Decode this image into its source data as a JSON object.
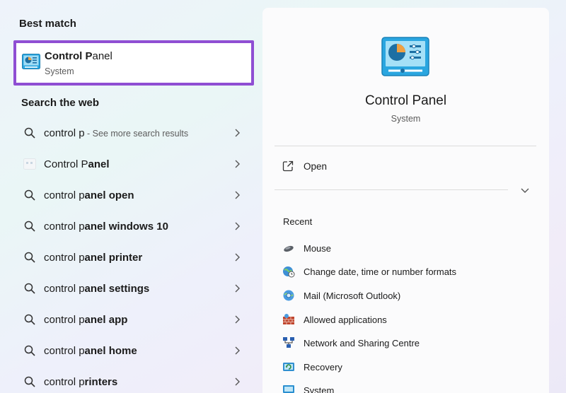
{
  "left": {
    "best_match_title": "Best match",
    "best_match": {
      "title_bold": "Control P",
      "title_rest": "anel",
      "subtitle": "System",
      "icon": "control-panel-icon"
    },
    "web_title": "Search the web",
    "web_results": [
      {
        "bold": "control p",
        "rest": "",
        "hint": " - See more search results",
        "icon": "search-icon"
      },
      {
        "bold": "",
        "rest": "Control P",
        "rest_bold": "anel",
        "hint": "",
        "icon": "control-panel-small-icon"
      },
      {
        "bold": "control p",
        "rest": "anel open",
        "hint": "",
        "icon": "search-icon"
      },
      {
        "bold": "control p",
        "rest": "anel windows 10",
        "hint": "",
        "icon": "search-icon"
      },
      {
        "bold": "control p",
        "rest": "anel printer",
        "hint": "",
        "icon": "search-icon"
      },
      {
        "bold": "control p",
        "rest": "anel settings",
        "hint": "",
        "icon": "search-icon"
      },
      {
        "bold": "control p",
        "rest": "anel app",
        "hint": "",
        "icon": "search-icon"
      },
      {
        "bold": "control p",
        "rest": "anel home",
        "hint": "",
        "icon": "search-icon"
      },
      {
        "bold": "control p",
        "rest": "rinters",
        "hint": "",
        "icon": "search-icon"
      }
    ]
  },
  "right": {
    "app_title": "Control Panel",
    "app_subtitle": "System",
    "open_label": "Open",
    "recent_label": "Recent",
    "recent_items": [
      {
        "label": "Mouse",
        "icon": "mouse-icon"
      },
      {
        "label": "Change date, time or number formats",
        "icon": "globe-clock-icon"
      },
      {
        "label": "Mail (Microsoft Outlook)",
        "icon": "mail-globe-icon"
      },
      {
        "label": "Allowed applications",
        "icon": "firewall-icon"
      },
      {
        "label": "Network and Sharing Centre",
        "icon": "network-icon"
      },
      {
        "label": "Recovery",
        "icon": "recovery-icon"
      },
      {
        "label": "System",
        "icon": "system-icon"
      }
    ]
  }
}
